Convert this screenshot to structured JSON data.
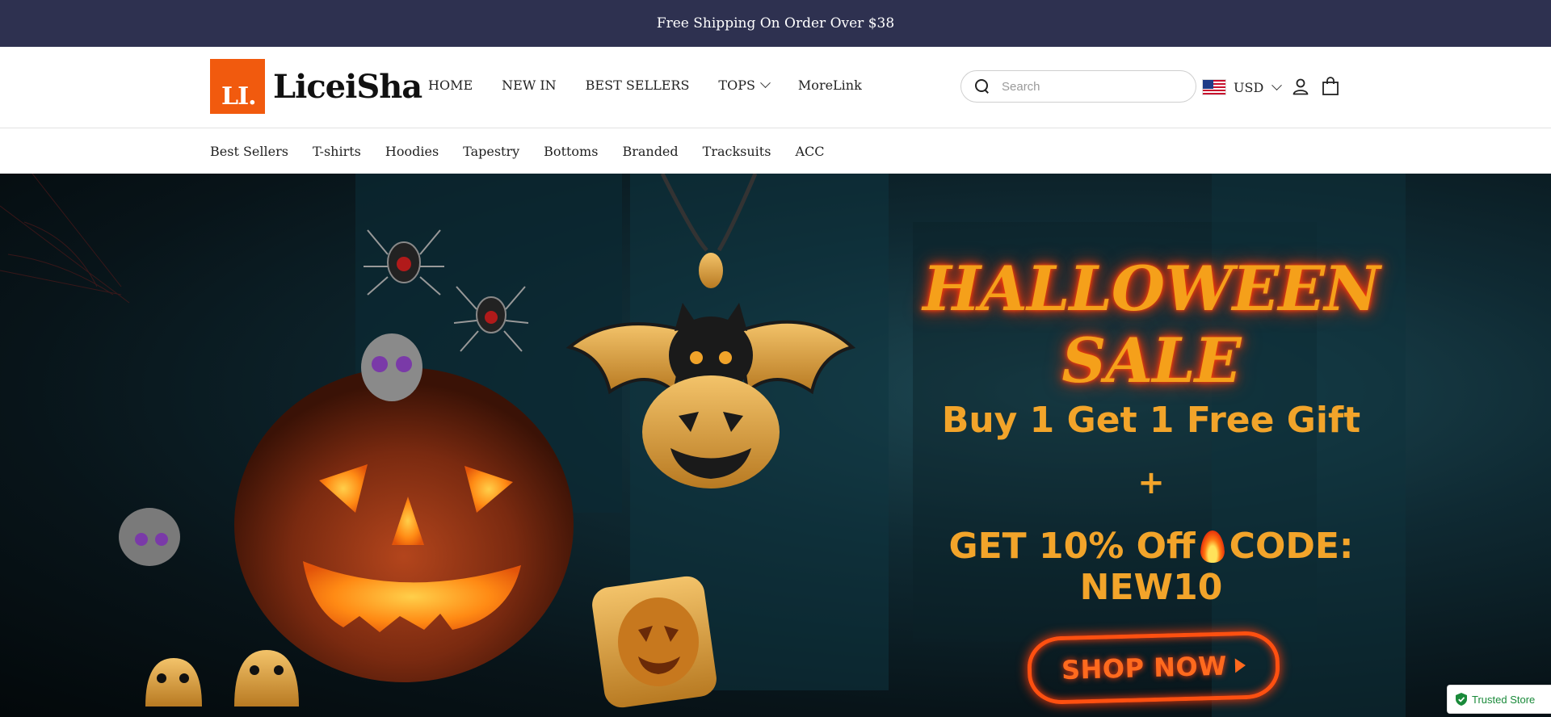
{
  "announcement": {
    "text": "Free Shipping On Order Over $38"
  },
  "brand": {
    "mark": "LI.",
    "name": "LiceiSha",
    "color": "#f15a0e"
  },
  "main_nav": [
    {
      "label": "HOME"
    },
    {
      "label": "NEW IN"
    },
    {
      "label": "BEST SELLERS"
    },
    {
      "label": "TOPS",
      "has_dropdown": true
    },
    {
      "label": "MoreLink"
    }
  ],
  "search": {
    "placeholder": "Search",
    "value": ""
  },
  "currency": {
    "label": "USD",
    "flag": "us-flag"
  },
  "icons": {
    "account": "account-icon",
    "cart": "cart-icon",
    "search": "search-icon"
  },
  "category_nav": [
    {
      "label": "Best Sellers"
    },
    {
      "label": "T-shirts"
    },
    {
      "label": "Hoodies"
    },
    {
      "label": "Tapestry"
    },
    {
      "label": "Bottoms"
    },
    {
      "label": "Branded"
    },
    {
      "label": "Tracksuits"
    },
    {
      "label": "ACC"
    }
  ],
  "hero": {
    "title": "HALLOWEEN SALE",
    "line1": "Buy 1 Get 1 Free Gift",
    "plus": "+",
    "line2_a": "GET 10% Off",
    "line2_b": "CODE: NEW10",
    "cta": "SHOP NOW",
    "accent_color": "#f2a42a",
    "glow_color": "#ff3a0a"
  },
  "trust_badge": {
    "label": "Trusted Store",
    "color": "#1a8a3a"
  },
  "colors": {
    "announcement_bg": "#2e3150"
  }
}
